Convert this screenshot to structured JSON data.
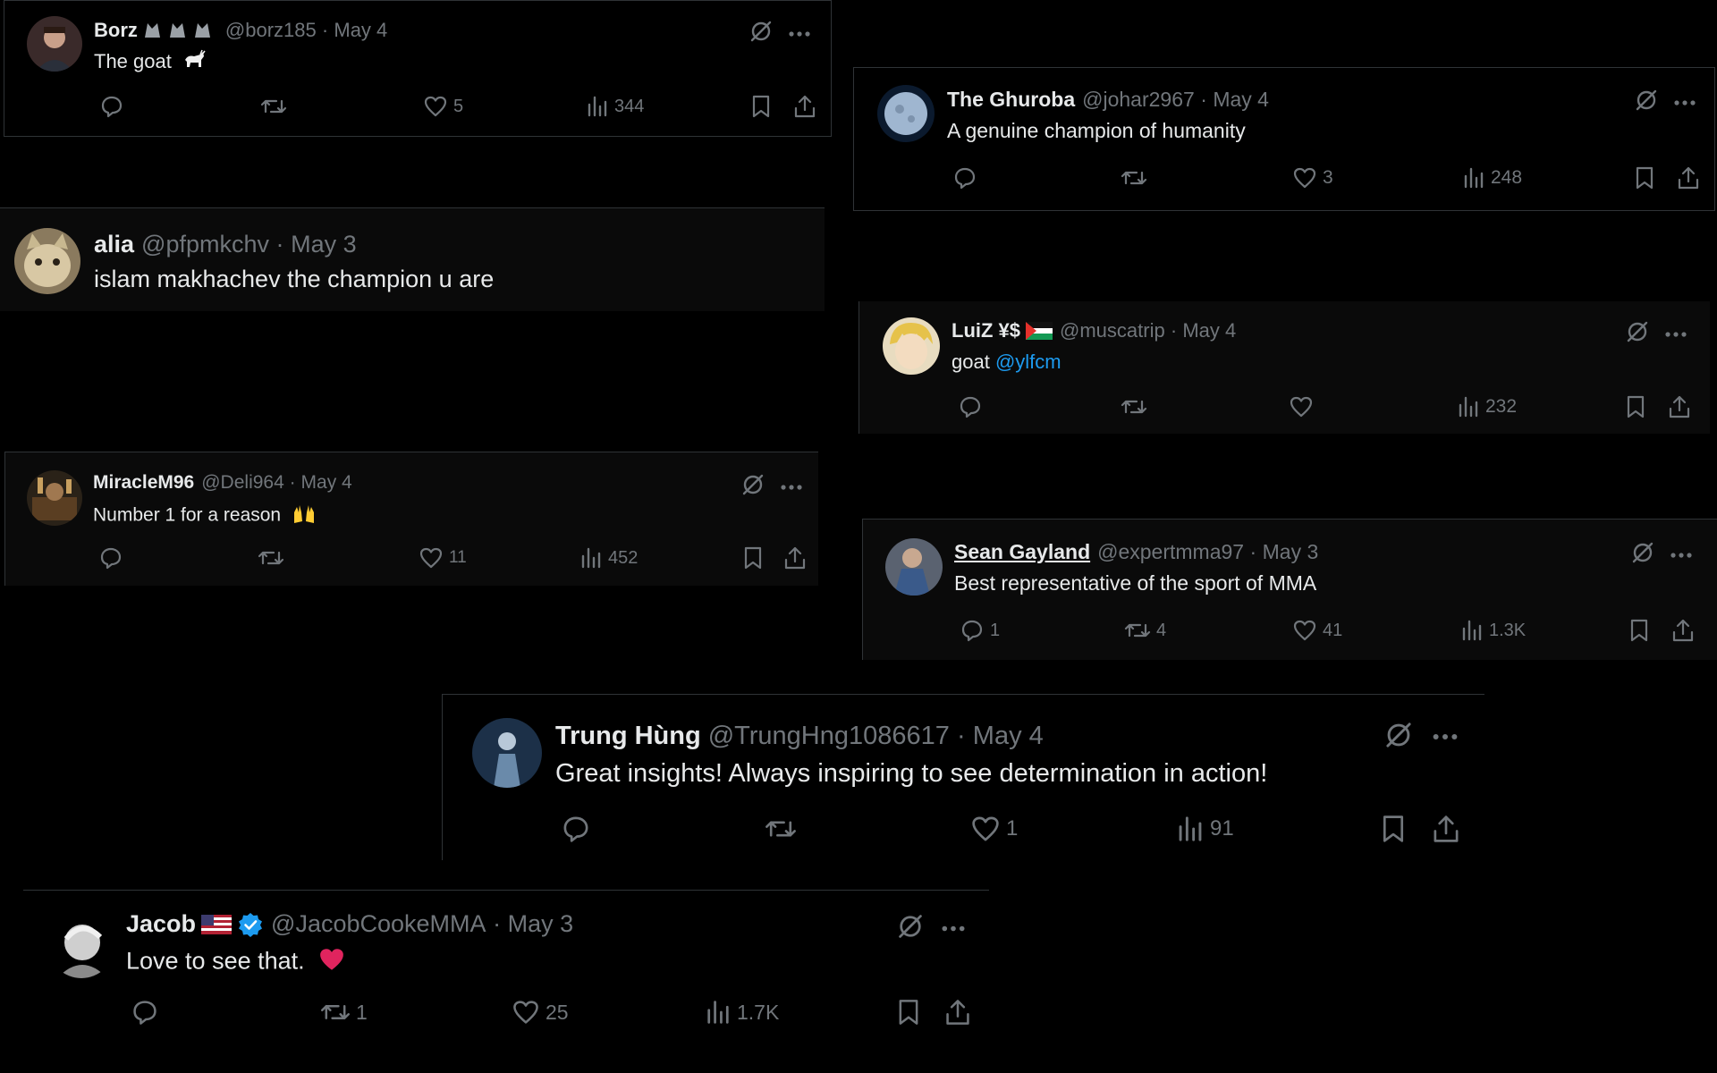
{
  "tweets": [
    {
      "name": "Borz",
      "emoji": "wolf-emoji x3",
      "handle": "@borz185",
      "date": "May 4",
      "text": "The goat",
      "likes": "5",
      "views": "344"
    },
    {
      "name": "The Ghuroba",
      "handle": "@johar2967",
      "date": "May 4",
      "text": "A genuine champion of humanity",
      "likes": "3",
      "views": "248"
    },
    {
      "name": "alia",
      "handle": "@pfpmkchv",
      "date": "May 3",
      "text": "islam makhachev the champion u are"
    },
    {
      "name": "LuiZ ¥$",
      "emoji": "palestine-flag-emoji",
      "handle": "@muscatrip",
      "date": "May 4",
      "text": "goat",
      "mention": "@ylfcm",
      "views": "232"
    },
    {
      "name": "MiracleM96",
      "handle": "@Deli964",
      "date": "May 4",
      "text": "Number 1 for a reason",
      "likes": "11",
      "views": "452"
    },
    {
      "name": "Sean Gayland",
      "handle": "@expertmma97",
      "date": "May 3",
      "text": "Best representative of the sport of MMA",
      "replies": "1",
      "reposts": "4",
      "likes": "41",
      "views": "1.3K"
    },
    {
      "name": "Trung Hùng",
      "handle": "@TrungHng1086617",
      "date": "May 4",
      "text": "Great insights! Always inspiring to see determination in action!",
      "likes": "1",
      "views": "91"
    },
    {
      "name": "Jacob",
      "emoji": "us-flag-emoji",
      "verified": true,
      "handle": "@JacobCookeMMA",
      "date": "May 3",
      "text": "Love to see that.",
      "reposts": "1",
      "likes": "25",
      "views": "1.7K"
    }
  ],
  "separator": "·",
  "colors": {
    "background": "#000000",
    "text": "#e7e9ea",
    "muted": "#71767b",
    "link": "#1d9bf0",
    "verified": "#1d9bf0",
    "heart_emoji": "#f91880"
  },
  "icons": [
    "reply-icon",
    "repost-icon",
    "like-icon",
    "views-icon",
    "bookmark-icon",
    "share-icon",
    "grok-icon",
    "more-icon"
  ]
}
